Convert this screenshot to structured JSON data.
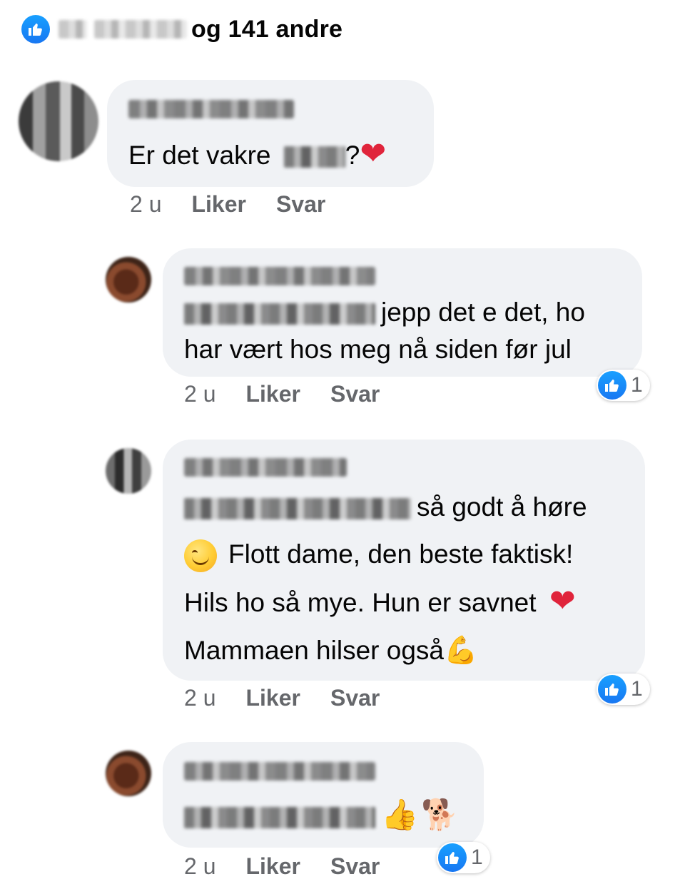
{
  "summary": {
    "likes_text": "og 141 andre",
    "reaction_icon": "like-icon"
  },
  "colors": {
    "like_blue": "#1877f2",
    "bubble_bg": "#f0f2f5",
    "meta_gray": "#65676b",
    "heart_red": "#e0243b"
  },
  "comments": [
    {
      "text_before": "Er det vakre",
      "text_after": "?",
      "emoji_end": "❤",
      "time": "2 u",
      "like_label": "Liker",
      "reply_label": "Svar"
    },
    {
      "text_line1": "jepp det e det, ho",
      "text_line2": "har vært hos meg nå siden før jul",
      "time": "2 u",
      "like_label": "Liker",
      "reply_label": "Svar",
      "reaction_count": "1"
    },
    {
      "text_line1": "så godt å høre",
      "text_line2": "Flott dame, den beste faktisk!",
      "text_line3": "Hils ho så mye. Hun er savnet",
      "text_line4": "Mammaen hilser også",
      "emoji_heart": "❤",
      "emoji_muscle": "💪",
      "time": "2 u",
      "like_label": "Liker",
      "reply_label": "Svar",
      "reaction_count": "1"
    },
    {
      "emoji_thumb": "👍",
      "emoji_dog": "🐕",
      "time": "2 u",
      "like_label": "Liker",
      "reply_label": "Svar",
      "reaction_count": "1"
    }
  ]
}
